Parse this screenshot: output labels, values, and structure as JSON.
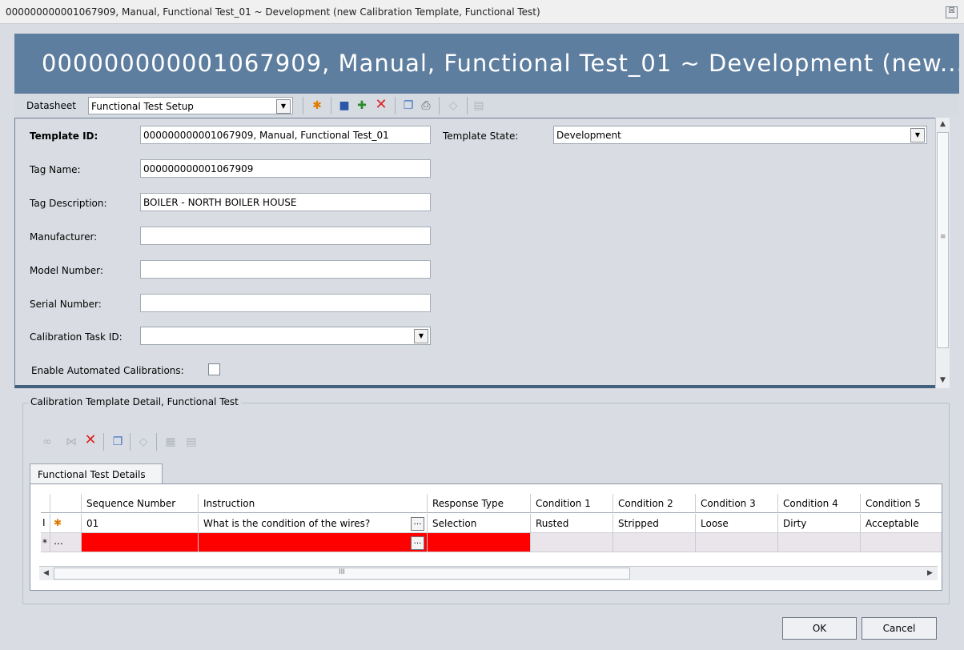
{
  "window": {
    "title": "000000000001067909, Manual, Functional Test_01 ~ Development (new Calibration Template, Functional Test)",
    "close_glyph": "☒"
  },
  "banner": {
    "title": "000000000001067909, Manual, Functional Test_01 ~ Development (new..."
  },
  "toolbar": {
    "datasheet_label": "Datasheet",
    "datasheet_value": "Functional Test Setup"
  },
  "form": {
    "template_id": {
      "label": "Template ID:",
      "value": "000000000001067909, Manual, Functional Test_01"
    },
    "template_state": {
      "label": "Template State:",
      "value": "Development"
    },
    "tag_name": {
      "label": "Tag Name:",
      "value": "000000000001067909"
    },
    "tag_description": {
      "label": "Tag Description:",
      "value": "BOILER - NORTH BOILER HOUSE"
    },
    "manufacturer": {
      "label": "Manufacturer:",
      "value": ""
    },
    "model_number": {
      "label": "Model Number:",
      "value": ""
    },
    "serial_number": {
      "label": "Serial Number:",
      "value": ""
    },
    "calibration_task_id": {
      "label": "Calibration Task ID:",
      "value": ""
    },
    "enable_automated": {
      "label": "Enable Automated Calibrations:",
      "checked": false
    }
  },
  "detail": {
    "group_title": "Calibration Template Detail, Functional Test",
    "tab_label": "Functional Test Details",
    "columns": [
      "Sequence Number",
      "Instruction",
      "Response Type",
      "Condition 1",
      "Condition 2",
      "Condition 3",
      "Condition 4",
      "Condition 5"
    ],
    "rows": [
      [
        "01",
        "What is the condition of the wires?",
        "Selection",
        "Rusted",
        "Stripped",
        "Loose",
        "Dirty",
        "Acceptable"
      ]
    ],
    "new_row_marker": "*",
    "scroll_mid": "III"
  },
  "buttons": {
    "ok": "OK",
    "cancel": "Cancel"
  },
  "colors": {
    "banner": "#5e7ea0",
    "required": "#ff0000"
  }
}
